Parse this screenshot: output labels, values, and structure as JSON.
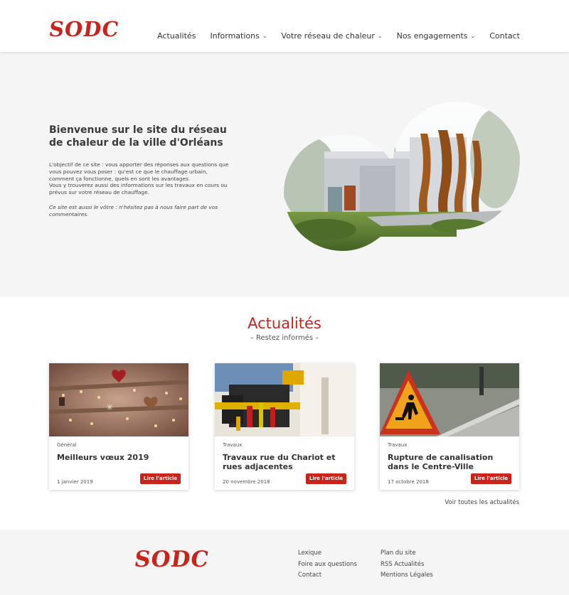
{
  "header": {
    "logo": "SODC",
    "nav": [
      {
        "label": "Actualités"
      },
      {
        "label": "Informations",
        "dropdown": true
      },
      {
        "label": "Votre réseau de chaleur",
        "dropdown": true
      },
      {
        "label": "Nos engagements",
        "dropdown": true
      },
      {
        "label": "Contact"
      }
    ]
  },
  "hero": {
    "title": "Bienvenue sur le site du réseau de chaleur de la ville d'Orléans",
    "paragraph1": "L'objectif de ce site : vous apporter des réponses aux questions que vous pouvez vous poser : qu'est ce que le chauffage urbain, comment ça fonctionne, quels en sont les avantages.",
    "paragraph2": "Vous y trouverez aussi des informations sur les travaux en cours ou prévus sur votre réseau de chauffage.",
    "italic": "Ce site est aussi le vôtre : n'hésitez pas à nous faire part de vos commentaires."
  },
  "news": {
    "title": "Actualités",
    "subtitle": "– Restez informés –",
    "read_label": "Lire l'article",
    "see_all": "Voir toutes les actualités",
    "cards": [
      {
        "category": "Général",
        "title": "Meilleurs vœux 2019",
        "date": "1 janvier 2019"
      },
      {
        "category": "Travaux",
        "title": "Travaux rue du Chariot et rues adjacentes",
        "date": "20 novembre 2018"
      },
      {
        "category": "Travaux",
        "title": "Rupture de canalisation dans le Centre-Ville",
        "date": "17 octobre 2018"
      }
    ]
  },
  "footer": {
    "logo": "SODC",
    "col1": [
      "Lexique",
      "Foire aux questions",
      "Contact"
    ],
    "col2": [
      "Plan du site",
      "RSS Actualités",
      "Mentions Légales"
    ]
  },
  "colors": {
    "brand_red": "#c8241b",
    "background_grey": "#f5f5f5"
  }
}
